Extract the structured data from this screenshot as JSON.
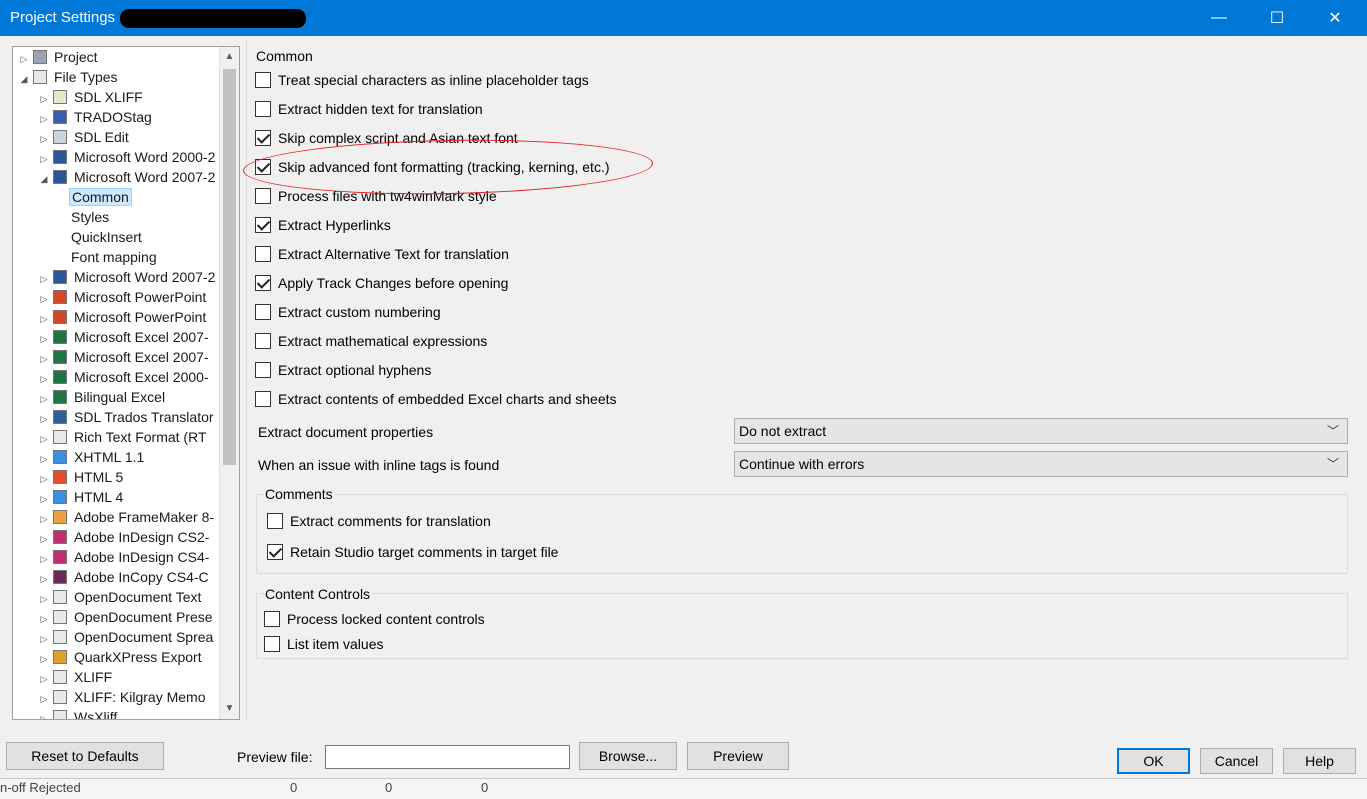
{
  "window": {
    "title": "Project Settings -",
    "minimize_glyph": "—",
    "maximize_glyph": "☐",
    "close_glyph": "✕"
  },
  "tree": {
    "items": [
      {
        "label": "Project",
        "icon": "gear-icon",
        "level": 0,
        "expander": "▷",
        "iconbg": "#9aa4b0"
      },
      {
        "label": "File Types",
        "icon": "list-icon",
        "level": 0,
        "expander": "◢",
        "iconbg": "#e8e8e8"
      },
      {
        "label": "SDL XLIFF",
        "icon": "doc-icon",
        "level": 1,
        "expander": "▷",
        "iconbg": "#dfe8c8"
      },
      {
        "label": "TRADOStag",
        "icon": "tag-icon",
        "level": 1,
        "expander": "▷",
        "iconbg": "#3a5ea8"
      },
      {
        "label": "SDL Edit",
        "icon": "pencil-icon",
        "level": 1,
        "expander": "▷",
        "iconbg": "#c9d3de"
      },
      {
        "label": "Microsoft Word 2000-2",
        "icon": "word-icon",
        "level": 1,
        "expander": "▷",
        "iconbg": "#2b579a"
      },
      {
        "label": "Microsoft Word 2007-2",
        "icon": "word-icon",
        "level": 1,
        "expander": "◢",
        "iconbg": "#2b579a"
      },
      {
        "label": "Common",
        "icon": "",
        "level": 2,
        "expander": "",
        "iconbg": "",
        "selected": true
      },
      {
        "label": "Styles",
        "icon": "",
        "level": 2,
        "expander": "",
        "iconbg": ""
      },
      {
        "label": "QuickInsert",
        "icon": "",
        "level": 2,
        "expander": "",
        "iconbg": ""
      },
      {
        "label": "Font mapping",
        "icon": "",
        "level": 2,
        "expander": "",
        "iconbg": ""
      },
      {
        "label": "Microsoft Word 2007-2",
        "icon": "word-icon",
        "level": 1,
        "expander": "▷",
        "iconbg": "#2b579a"
      },
      {
        "label": "Microsoft PowerPoint",
        "icon": "powerpoint-icon",
        "level": 1,
        "expander": "▷",
        "iconbg": "#d24726"
      },
      {
        "label": "Microsoft PowerPoint",
        "icon": "powerpoint-icon",
        "level": 1,
        "expander": "▷",
        "iconbg": "#d24726"
      },
      {
        "label": "Microsoft Excel 2007-",
        "icon": "excel-icon",
        "level": 1,
        "expander": "▷",
        "iconbg": "#217346"
      },
      {
        "label": "Microsoft Excel 2007-",
        "icon": "excel-icon",
        "level": 1,
        "expander": "▷",
        "iconbg": "#217346"
      },
      {
        "label": "Microsoft Excel 2000-",
        "icon": "excel-icon",
        "level": 1,
        "expander": "▷",
        "iconbg": "#217346"
      },
      {
        "label": "Bilingual Excel",
        "icon": "excel-icon",
        "level": 1,
        "expander": "▷",
        "iconbg": "#217346"
      },
      {
        "label": "SDL Trados Translator",
        "icon": "grid-icon",
        "level": 1,
        "expander": "▷",
        "iconbg": "#2e5f99"
      },
      {
        "label": "Rich Text Format (RT",
        "icon": "doc-icon",
        "level": 1,
        "expander": "▷",
        "iconbg": "#e8e8e8"
      },
      {
        "label": "XHTML 1.1",
        "icon": "globe-icon",
        "level": 1,
        "expander": "▷",
        "iconbg": "#3a8ee6"
      },
      {
        "label": "HTML 5",
        "icon": "html5-icon",
        "level": 1,
        "expander": "▷",
        "iconbg": "#e34f26"
      },
      {
        "label": "HTML 4",
        "icon": "globe-icon",
        "level": 1,
        "expander": "▷",
        "iconbg": "#3a8ee6"
      },
      {
        "label": "Adobe FrameMaker 8-",
        "icon": "framemaker-icon",
        "level": 1,
        "expander": "▷",
        "iconbg": "#e8a040"
      },
      {
        "label": "Adobe InDesign CS2-",
        "icon": "indesign-icon",
        "level": 1,
        "expander": "▷",
        "iconbg": "#c03070"
      },
      {
        "label": "Adobe InDesign CS4-",
        "icon": "indesign-icon",
        "level": 1,
        "expander": "▷",
        "iconbg": "#c03070"
      },
      {
        "label": "Adobe InCopy CS4-C",
        "icon": "incopy-icon",
        "level": 1,
        "expander": "▷",
        "iconbg": "#6a2a5a"
      },
      {
        "label": "OpenDocument Text",
        "icon": "odt-icon",
        "level": 1,
        "expander": "▷",
        "iconbg": "#e8e8e8"
      },
      {
        "label": "OpenDocument Prese",
        "icon": "odp-icon",
        "level": 1,
        "expander": "▷",
        "iconbg": "#e8e8e8"
      },
      {
        "label": "OpenDocument Sprea",
        "icon": "ods-icon",
        "level": 1,
        "expander": "▷",
        "iconbg": "#e8e8e8"
      },
      {
        "label": "QuarkXPress Export",
        "icon": "quark-icon",
        "level": 1,
        "expander": "▷",
        "iconbg": "#e0a030"
      },
      {
        "label": "XLIFF",
        "icon": "xliff-icon",
        "level": 1,
        "expander": "▷",
        "iconbg": "#e8e8e8"
      },
      {
        "label": "XLIFF: Kilgray Memo",
        "icon": "xliff-icon",
        "level": 1,
        "expander": "▷",
        "iconbg": "#e8e8e8"
      },
      {
        "label": "WsXliff",
        "icon": "xliff-icon",
        "level": 1,
        "expander": "▷",
        "iconbg": "#e8e8e8"
      }
    ]
  },
  "main": {
    "common_label": "Common",
    "options": [
      {
        "label": "Treat special characters as inline placeholder tags",
        "checked": false
      },
      {
        "label": "Extract hidden text for translation",
        "checked": false
      },
      {
        "label": "Skip complex script and Asian text font",
        "checked": true
      },
      {
        "label": "Skip advanced font formatting (tracking, kerning, etc.)",
        "checked": true
      },
      {
        "label": "Process files with tw4winMark style",
        "checked": false
      },
      {
        "label": "Extract Hyperlinks",
        "checked": true
      },
      {
        "label": "Extract Alternative Text for translation",
        "checked": false
      },
      {
        "label": "Apply Track Changes before opening",
        "checked": true
      },
      {
        "label": "Extract custom numbering",
        "checked": false
      },
      {
        "label": "Extract mathematical expressions",
        "checked": false
      },
      {
        "label": "Extract optional hyphens",
        "checked": false
      },
      {
        "label": "Extract contents of embedded Excel charts and sheets",
        "checked": false
      }
    ],
    "doc_props_label": "Extract document properties",
    "doc_props_value": "Do not extract",
    "inline_tags_label": "When an issue with inline tags is found",
    "inline_tags_value": "Continue with errors",
    "comments": {
      "title": "Comments",
      "options": [
        {
          "label": "Extract comments for translation",
          "checked": false
        },
        {
          "label": "Retain Studio target comments in target file",
          "checked": true
        }
      ]
    },
    "content_controls": {
      "title": "Content Controls",
      "options": [
        {
          "label": "Process locked content controls",
          "checked": false
        },
        {
          "label": "List item values",
          "checked": false
        }
      ]
    }
  },
  "bottom": {
    "reset_label": "Reset to Defaults",
    "preview_file_label": "Preview file:",
    "preview_file_value": "",
    "browse_label": "Browse...",
    "preview_label": "Preview",
    "ok_label": "OK",
    "cancel_label": "Cancel",
    "help_label": "Help"
  },
  "underlying": {
    "row_label": "n-off Rejected",
    "values": [
      "0",
      "0",
      "0"
    ]
  },
  "colors": {
    "titlebar": "#0078d7",
    "annotation": "#e02020"
  }
}
